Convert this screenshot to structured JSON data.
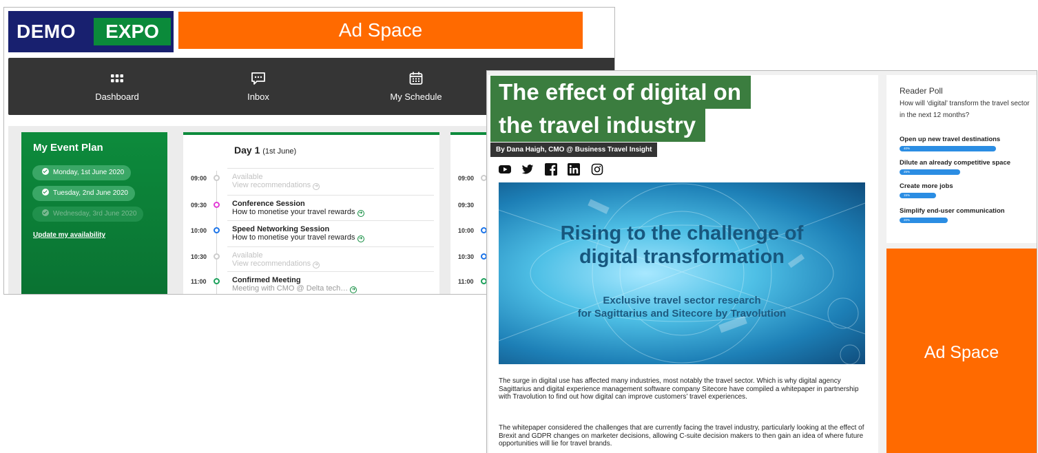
{
  "expo": {
    "logo": {
      "demo": "DEMO",
      "expo": "EXPO"
    },
    "ad_top": "Ad Space",
    "nav": [
      {
        "label": "Dashboard",
        "icon": "dashboard-grid-icon"
      },
      {
        "label": "Inbox",
        "icon": "chat-bubble-icon"
      },
      {
        "label": "My Schedule",
        "icon": "calendar-icon"
      }
    ],
    "event_plan": {
      "title": "My Event Plan",
      "days": [
        "Monday, 1st June 2020",
        "Tuesday, 2nd June 2020",
        "Wednesday, 3rd June 2020"
      ],
      "update_link": "Update my availability"
    },
    "day1": {
      "title": "Day 1",
      "date": "(1st June)",
      "slots": [
        {
          "time": "09:00",
          "title": "Available",
          "sub": "View recommendations",
          "status": "available"
        },
        {
          "time": "09:30",
          "title": "Conference Session",
          "sub": "How to monetise your travel rewards",
          "status": "conference",
          "color": "#e23ad6"
        },
        {
          "time": "10:00",
          "title": "Speed Networking Session",
          "sub": "How to monetise your travel rewards",
          "status": "networking",
          "color": "#1a73e8"
        },
        {
          "time": "10:30",
          "title": "Available",
          "sub": "View recommendations",
          "status": "available"
        },
        {
          "time": "11:00",
          "title": "Confirmed Meeting",
          "sub": "Meeting with CMO @ Delta tech…",
          "status": "meeting",
          "color": "#1aa05a"
        }
      ]
    },
    "day2": {
      "times": [
        "09:00",
        "09:30",
        "10:00",
        "10:30",
        "11:00"
      ]
    }
  },
  "article": {
    "title_line1": "The effect of digital on",
    "title_line2": "the travel industry",
    "byline": "By Dana Haigh, CMO @ Business Travel Insight",
    "social": [
      "youtube-icon",
      "twitter-icon",
      "facebook-icon",
      "linkedin-icon",
      "instagram-icon"
    ],
    "hero": {
      "headline_1": "Rising to the challenge of",
      "headline_2": "digital transformation",
      "sub_1": "Exclusive travel sector research",
      "sub_2": "for Sagittarius and Sitecore by Travolution"
    },
    "paragraph_1": "The surge in digital use has affected many industries, most notably the travel sector. Which is why digital agency Sagittarius and digital experience management software company Sitecore have compiled a whitepaper in partnership with Travolution to find out how digital can improve customers’ travel experiences.",
    "paragraph_2": "The whitepaper considered the challenges that are currently facing the travel industry, particularly looking at the effect of Brexit and GDPR changes on marketer decisions, allowing C-suite decision makers to then gain an idea of where future opportunities will lie for travel brands."
  },
  "poll": {
    "title": "Reader Poll",
    "question": "How will ‘digital’ transform the travel sector in the next 12 months?",
    "options": [
      {
        "label": "Open up new travel destinations",
        "percent": 40,
        "percent_label": "40%"
      },
      {
        "label": "Dilute an already competitive space",
        "percent": 25,
        "percent_label": "25%"
      },
      {
        "label": "Create more jobs",
        "percent": 15,
        "percent_label": "15%"
      },
      {
        "label": "Simplify end-user communication",
        "percent": 20,
        "percent_label": "20%"
      }
    ]
  },
  "ad_side": "Ad Space",
  "colors": {
    "brand_navy": "#18206f",
    "brand_green": "#0b8a3a",
    "ad_orange": "#ff6a00",
    "title_green": "#3b7d3f",
    "poll_blue": "#2b8de3"
  }
}
